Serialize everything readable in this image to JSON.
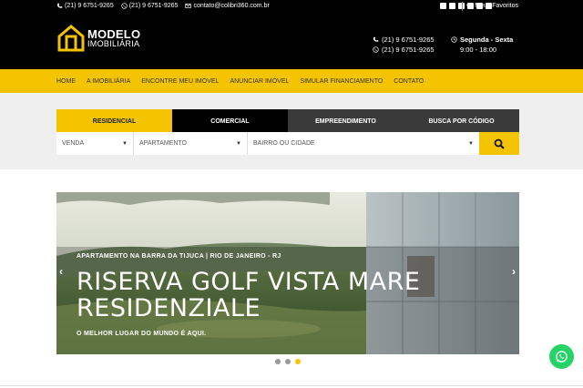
{
  "topbar": {
    "phone1": "(21) 9 6751-9265",
    "phone2": "(21) 9 6751-9265",
    "email": "contato@colibri360.com.br",
    "social_icons": [
      "facebook-icon",
      "instagram-icon",
      "twitter-icon",
      "youtube-icon",
      "linkedin-icon",
      "email-icon"
    ],
    "favorites_label": "Meus Favoritos"
  },
  "logo": {
    "title": "MODELO",
    "subtitle": "IMOBILIÁRIA"
  },
  "header_contact": {
    "phone": "(21) 9 6751-9265",
    "whatsapp": "(21) 9 6751-9265",
    "days": "Segunda - Sexta",
    "hours": "9:00 - 18:00"
  },
  "nav": {
    "items": [
      "HOME",
      "A IMOBILIÁRIA",
      "ENCONTRE MEU IMÓVEL",
      "ANUNCIAR IMÓVEL",
      "SIMULAR FINANCIAMENTO",
      "CONTATO"
    ]
  },
  "search": {
    "tabs": [
      "RESIDENCIAL",
      "COMERCIAL",
      "EMPREENDIMENTO",
      "BUSCA POR CÓDIGO"
    ],
    "active_tab": "RESIDENCIAL",
    "transaction": "VENDA",
    "property_type": "APARTAMENTO",
    "location_placeholder": "BAIRRO OU CIDADE"
  },
  "banner": {
    "subtitle": "APARTAMENTO NA BARRA DA TIJUCA | RIO DE JANEIRO - RJ",
    "title_line1": "RISERVA GOLF VISTA MARE",
    "title_line2": "RESIDENZIALE",
    "tagline": "O MELHOR LUGAR DO MUNDO É AQUI.",
    "slide_count": 3,
    "active_slide": 3
  },
  "colors": {
    "accent": "#f5c400",
    "topbar_bg": "#000000",
    "search_band_bg": "#efefef",
    "whatsapp": "#25d366"
  }
}
